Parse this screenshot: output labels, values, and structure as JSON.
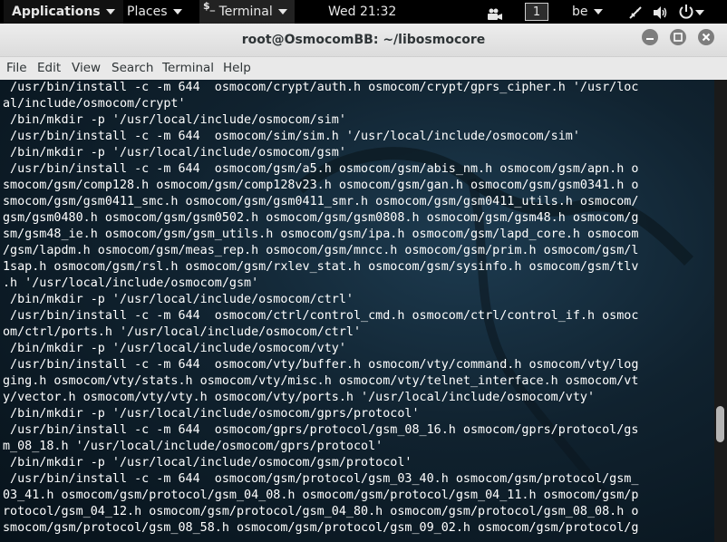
{
  "topbar": {
    "applications": "Applications",
    "places": "Places",
    "terminal_glyph": "$_",
    "terminal": "Terminal",
    "clock": "Wed 21:32",
    "workspace": "1",
    "language": "be"
  },
  "window": {
    "title": "root@OsmocomBB: ~/libosmocore"
  },
  "menubar": [
    "File",
    "Edit",
    "View",
    "Search",
    "Terminal",
    "Help"
  ],
  "terminal_lines": [
    " /usr/bin/install -c -m 644  osmocom/crypt/auth.h osmocom/crypt/gprs_cipher.h '/usr/loc",
    "al/include/osmocom/crypt'",
    " /bin/mkdir -p '/usr/local/include/osmocom/sim'",
    " /usr/bin/install -c -m 644  osmocom/sim/sim.h '/usr/local/include/osmocom/sim'",
    " /bin/mkdir -p '/usr/local/include/osmocom/gsm'",
    " /usr/bin/install -c -m 644  osmocom/gsm/a5.h osmocom/gsm/abis_nm.h osmocom/gsm/apn.h o",
    "smocom/gsm/comp128.h osmocom/gsm/comp128v23.h osmocom/gsm/gan.h osmocom/gsm/gsm0341.h o",
    "smocom/gsm/gsm0411_smc.h osmocom/gsm/gsm0411_smr.h osmocom/gsm/gsm0411_utils.h osmocom/",
    "gsm/gsm0480.h osmocom/gsm/gsm0502.h osmocom/gsm/gsm0808.h osmocom/gsm/gsm48.h osmocom/g",
    "sm/gsm48_ie.h osmocom/gsm/gsm_utils.h osmocom/gsm/ipa.h osmocom/gsm/lapd_core.h osmocom",
    "/gsm/lapdm.h osmocom/gsm/meas_rep.h osmocom/gsm/mncc.h osmocom/gsm/prim.h osmocom/gsm/l",
    "1sap.h osmocom/gsm/rsl.h osmocom/gsm/rxlev_stat.h osmocom/gsm/sysinfo.h osmocom/gsm/tlv",
    ".h '/usr/local/include/osmocom/gsm'",
    " /bin/mkdir -p '/usr/local/include/osmocom/ctrl'",
    " /usr/bin/install -c -m 644  osmocom/ctrl/control_cmd.h osmocom/ctrl/control_if.h osmoc",
    "om/ctrl/ports.h '/usr/local/include/osmocom/ctrl'",
    " /bin/mkdir -p '/usr/local/include/osmocom/vty'",
    " /usr/bin/install -c -m 644  osmocom/vty/buffer.h osmocom/vty/command.h osmocom/vty/log",
    "ging.h osmocom/vty/stats.h osmocom/vty/misc.h osmocom/vty/telnet_interface.h osmocom/vt",
    "y/vector.h osmocom/vty/vty.h osmocom/vty/ports.h '/usr/local/include/osmocom/vty'",
    " /bin/mkdir -p '/usr/local/include/osmocom/gprs/protocol'",
    " /usr/bin/install -c -m 644  osmocom/gprs/protocol/gsm_08_16.h osmocom/gprs/protocol/gs",
    "m_08_18.h '/usr/local/include/osmocom/gprs/protocol'",
    " /bin/mkdir -p '/usr/local/include/osmocom/gsm/protocol'",
    " /usr/bin/install -c -m 644  osmocom/gsm/protocol/gsm_03_40.h osmocom/gsm/protocol/gsm_",
    "03_41.h osmocom/gsm/protocol/gsm_04_08.h osmocom/gsm/protocol/gsm_04_11.h osmocom/gsm/p",
    "rotocol/gsm_04_12.h osmocom/gsm/protocol/gsm_04_80.h osmocom/gsm/protocol/gsm_08_08.h o",
    "smocom/gsm/protocol/gsm_08_58.h osmocom/gsm/protocol/gsm_09_02.h osmocom/gsm/protocol/g"
  ],
  "colors": {
    "topbar_bg": "#000000",
    "terminal_text": "#ffffff",
    "terminal_bg": "#10222f"
  },
  "icons": [
    "video-camera-icon",
    "network-icon",
    "volume-icon",
    "power-icon",
    "kali-dragon-watermark"
  ]
}
